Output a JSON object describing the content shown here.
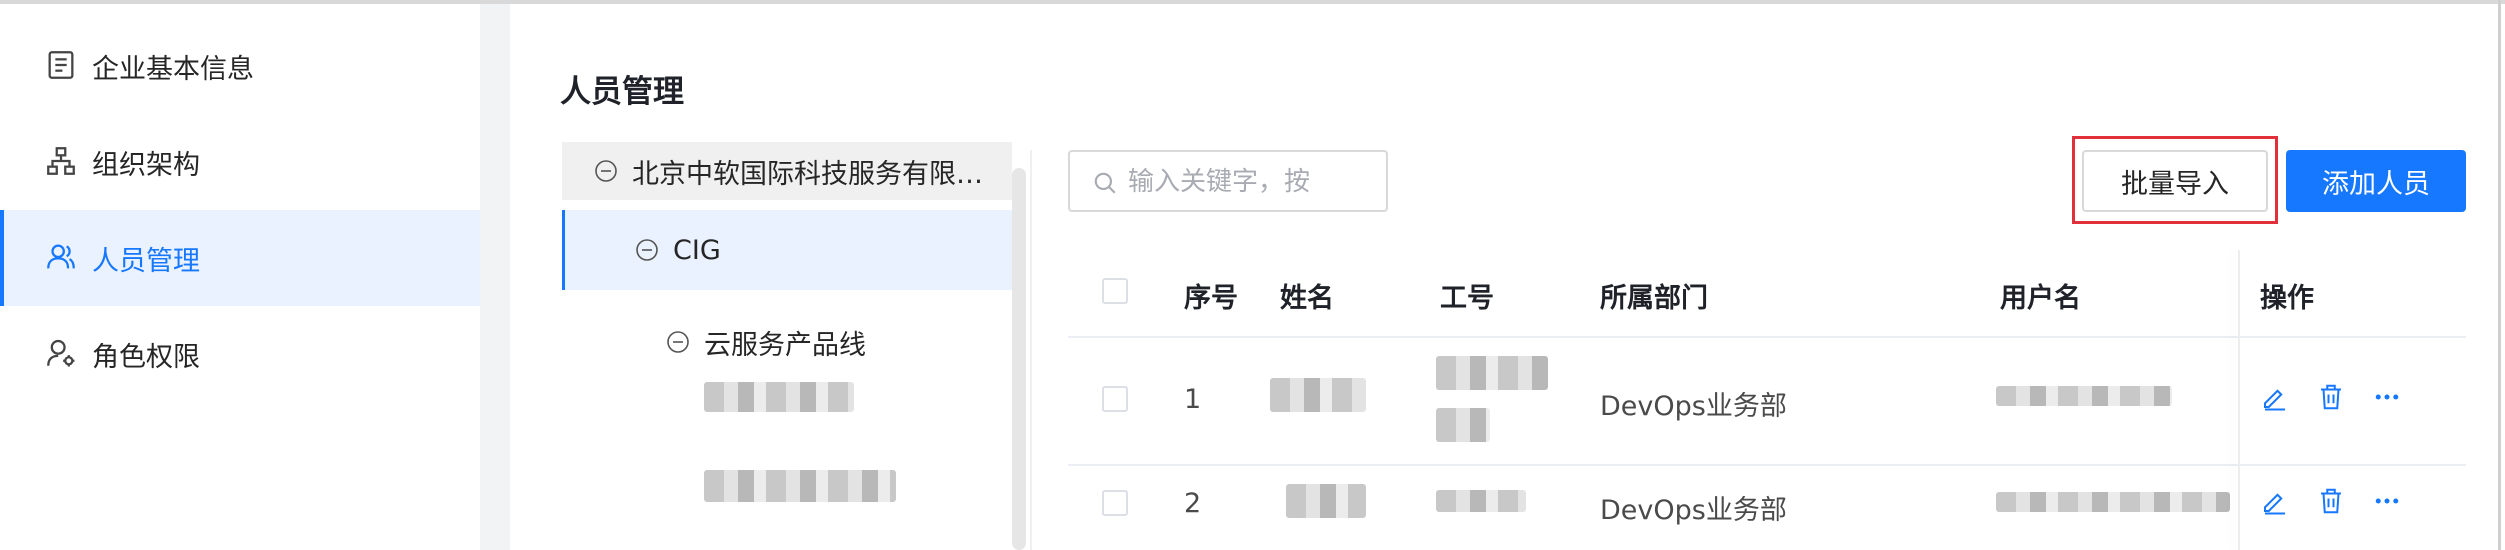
{
  "sidebar": {
    "items": [
      {
        "label": "企业基本信息",
        "icon": "document-list-icon"
      },
      {
        "label": "组织架构",
        "icon": "org-chart-icon"
      },
      {
        "label": "人员管理",
        "icon": "users-icon"
      },
      {
        "label": "角色权限",
        "icon": "user-settings-icon"
      }
    ],
    "active_index": 2
  },
  "page": {
    "title": "人员管理"
  },
  "tree": {
    "root": "北京中软国际科技服务有限…",
    "child": "CIG",
    "grandchild": "云服务产品线"
  },
  "toolbar": {
    "search_placeholder": "输入关键字，按",
    "import_label": "批量导入",
    "add_label": "添加人员"
  },
  "table": {
    "columns": [
      "序号",
      "姓名",
      "工号",
      "所属部门",
      "用户名",
      "操作"
    ],
    "rows": [
      {
        "index": "1",
        "department": "DevOps业务部"
      },
      {
        "index": "2",
        "department": "DevOps业务部"
      }
    ]
  },
  "colors": {
    "accent": "#1677ff",
    "highlight": "#e0303a"
  }
}
